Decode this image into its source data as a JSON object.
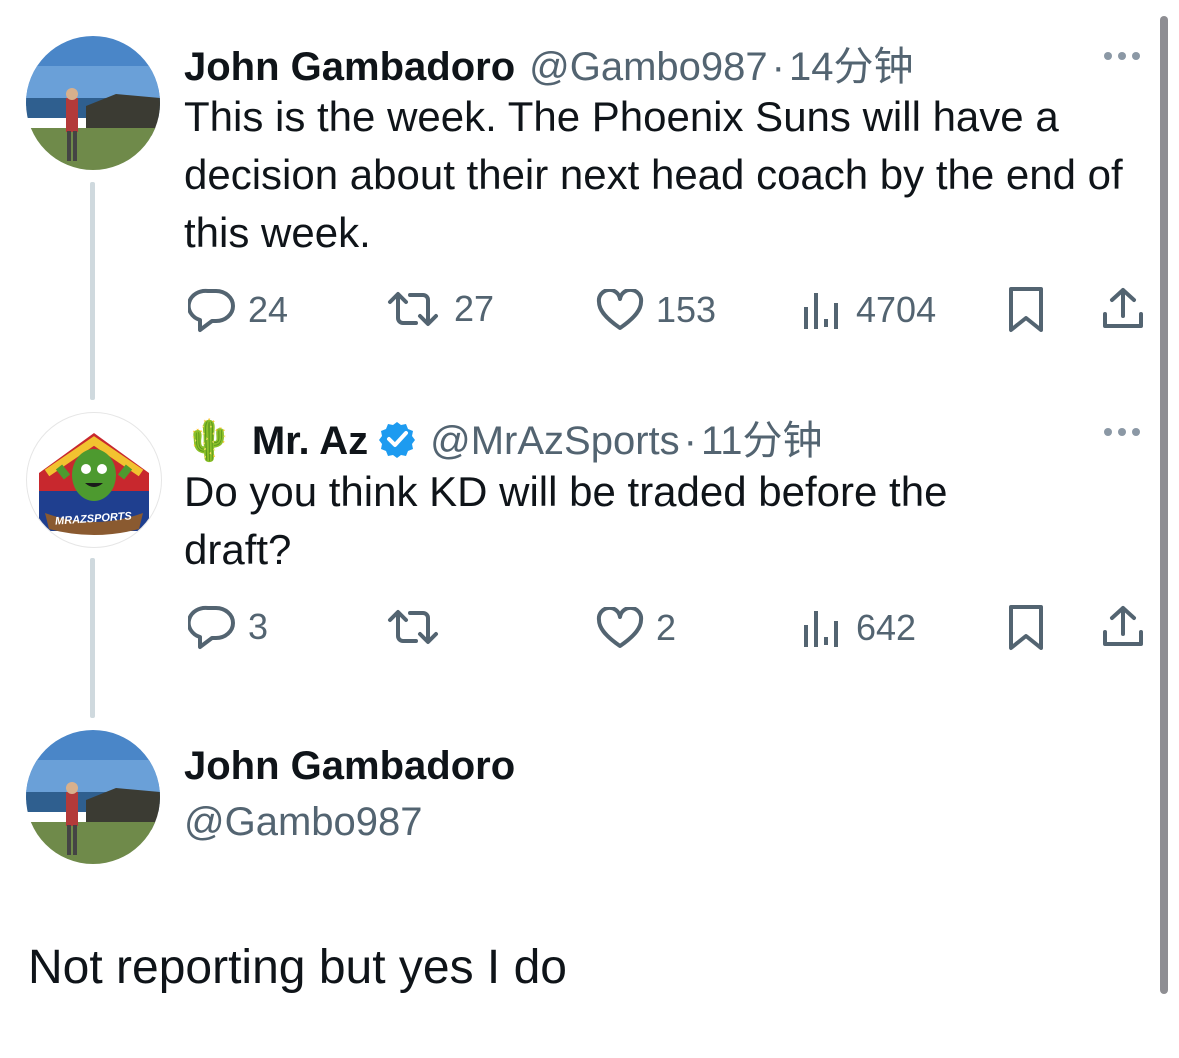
{
  "tweet1": {
    "name": "John Gambadoro",
    "handle": "@Gambo987",
    "separator": "·",
    "time": "14分钟",
    "text": "This is the week. The Phoenix Suns will have a decision about their next head coach by the end of this week.",
    "replies": "24",
    "retweets": "27",
    "likes": "153",
    "views": "4704"
  },
  "tweet2": {
    "emoji": "🌵",
    "name": "Mr. Az",
    "handle": "@MrAzSports",
    "separator": "·",
    "time": "11分钟",
    "text": "Do you think KD will be traded before the draft?",
    "avatar_label": "MRAZSPORTS",
    "replies": "3",
    "retweets": "",
    "likes": "2",
    "views": "642"
  },
  "tweet3": {
    "name": "John Gambadoro",
    "handle": "@Gambo987",
    "text": "Not reporting but yes I do"
  },
  "icons": {
    "reply": "reply-icon",
    "retweet": "retweet-icon",
    "like": "heart-icon",
    "views": "views-icon",
    "bookmark": "bookmark-icon",
    "share": "share-icon",
    "more": "more-icon",
    "verified": "verified-badge-icon"
  },
  "colors": {
    "text": "#0f1419",
    "secondary": "#536471",
    "verified": "#1d9bf0",
    "thread_line": "#cfd9de"
  }
}
